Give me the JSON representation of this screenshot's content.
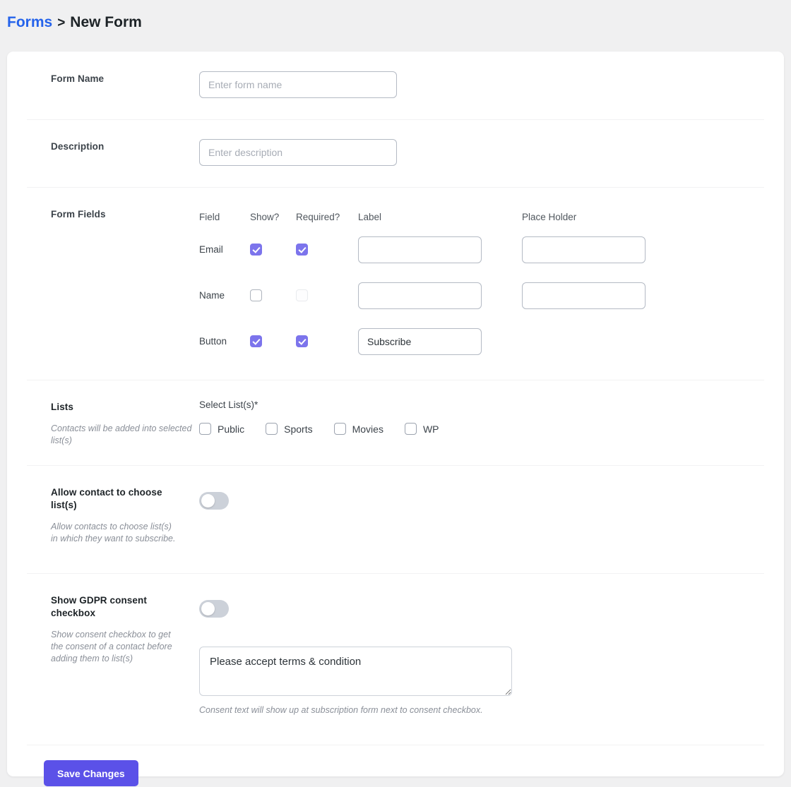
{
  "breadcrumb": {
    "root_label": "Forms",
    "separator": ">",
    "current_label": "New Form"
  },
  "form": {
    "name_label": "Form Name",
    "name_value": "",
    "name_placeholder": "Enter form name",
    "description_label": "Description",
    "description_value": "",
    "description_placeholder": "Enter description"
  },
  "form_fields": {
    "section_label": "Form Fields",
    "columns": {
      "field": "Field",
      "show": "Show?",
      "required": "Required?",
      "label": "Label",
      "placeholder": "Place Holder"
    },
    "rows": [
      {
        "field": "Email",
        "show_checked": true,
        "required_checked": true,
        "required_disabled": false,
        "label_value": "",
        "placeholder_value": "",
        "has_placeholder_input": true,
        "disabled": false
      },
      {
        "field": "Name",
        "show_checked": false,
        "required_checked": false,
        "required_disabled": true,
        "label_value": "",
        "placeholder_value": "",
        "has_placeholder_input": true,
        "disabled": true
      },
      {
        "field": "Button",
        "show_checked": true,
        "required_checked": true,
        "required_disabled": false,
        "label_value": "Subscribe",
        "placeholder_value": "",
        "has_placeholder_input": false,
        "disabled": false
      }
    ]
  },
  "lists": {
    "section_label": "Lists",
    "hint": "Contacts will be added into selected list(s)",
    "select_label": "Select List(s)*",
    "options": [
      {
        "label": "Public",
        "checked": false
      },
      {
        "label": "Sports",
        "checked": false
      },
      {
        "label": "Movies",
        "checked": false
      },
      {
        "label": "WP",
        "checked": false
      }
    ]
  },
  "allow_choose": {
    "section_label": "Allow contact to choose list(s)",
    "hint": "Allow contacts to choose list(s) in which they want to subscribe.",
    "toggle_on": false
  },
  "gdpr": {
    "section_label": "Show GDPR consent checkbox",
    "hint": "Show consent checkbox to get the consent of a contact before adding them to list(s)",
    "toggle_on": false,
    "consent_text": "Please accept terms & condition",
    "consent_help": "Consent text will show up at subscription form next to consent checkbox."
  },
  "footer": {
    "save_label": "Save Changes"
  },
  "colors": {
    "accent": "#5b51e8",
    "checkbox": "#7c74ec",
    "link": "#2563eb",
    "page_background": "#f0f0f1",
    "toggle_off_track": "#ccd1d9"
  }
}
